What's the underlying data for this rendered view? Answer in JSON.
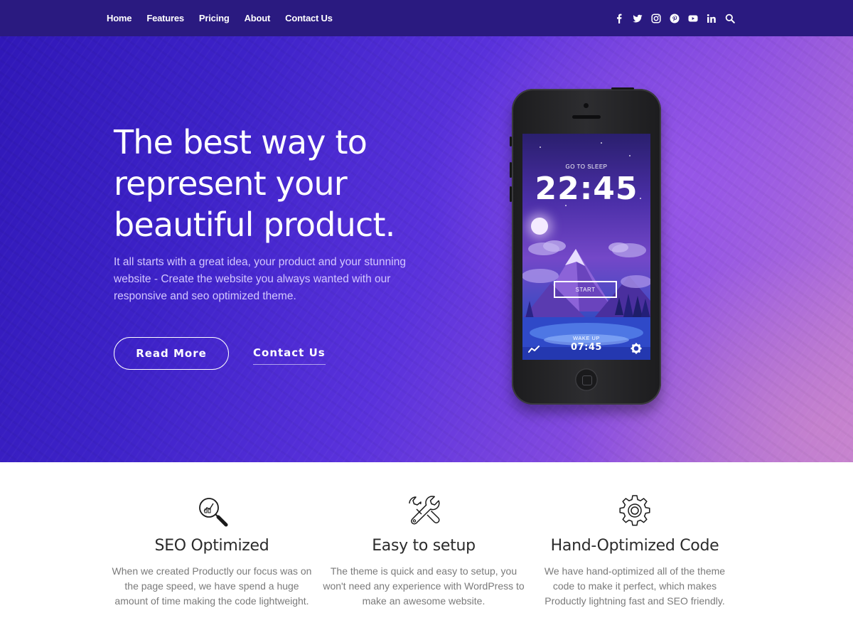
{
  "nav": {
    "links": [
      "Home",
      "Features",
      "Pricing",
      "About",
      "Contact Us"
    ],
    "social_icons": [
      "facebook-icon",
      "twitter-icon",
      "instagram-icon",
      "pinterest-icon",
      "youtube-icon",
      "linkedin-icon",
      "search-icon"
    ]
  },
  "hero": {
    "title_line1": "The best way to",
    "title_line2": "represent your",
    "title_line3": "beautiful product.",
    "description": "It all starts with a great idea, your product and your stunning website - Create the website you always wanted with our responsive and seo optimized theme.",
    "read_more": "Read More",
    "contact": "Contact Us"
  },
  "phone_screen": {
    "sleep_label": "GO TO SLEEP",
    "sleep_time": "22:45",
    "start_label": "START",
    "wake_label": "WAKE UP",
    "wake_time": "07:45"
  },
  "features": [
    {
      "icon": "seo-magnifier-icon",
      "title": "SEO Optimized",
      "text": "When we created Productly our focus was on the page speed, we have spend a huge amount of time making the code lightweight."
    },
    {
      "icon": "wrench-icon",
      "title": "Easy to setup",
      "text": "The theme is quick and easy to setup, you won't need any experience with WordPress to make an awesome website."
    },
    {
      "icon": "gear-icon",
      "title": "Hand-Optimized Code",
      "text": "We have hand-optimized all of the theme code to make it perfect, which makes Productly lightning fast and SEO friendly."
    }
  ],
  "colors": {
    "nav_bg": "#2a1a80",
    "hero_start": "#3018b8",
    "hero_end": "#c07ed4",
    "feature_title": "#2b2b2b",
    "feature_text": "#7a7a7a"
  }
}
